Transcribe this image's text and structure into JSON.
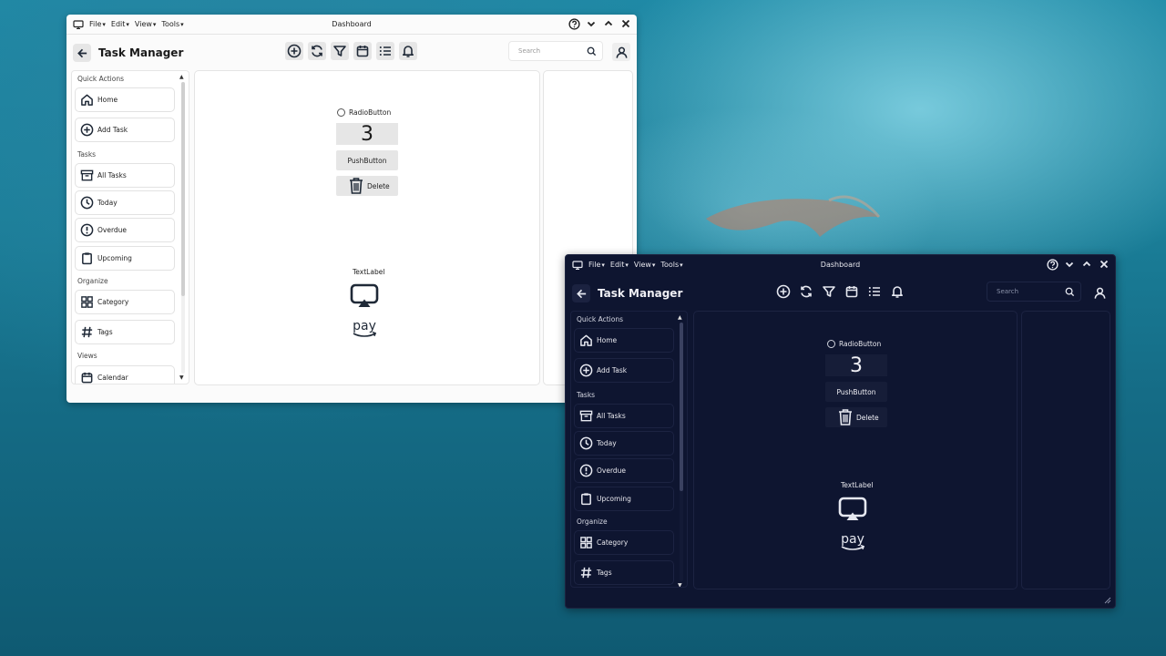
{
  "colors": {
    "light_fg": "#1f2937",
    "dark_fg": "#e6e8f0",
    "dark_bg": "#0e1530"
  },
  "window": {
    "title": "Dashboard",
    "menus": [
      "File",
      "Edit",
      "View",
      "Tools"
    ],
    "controls": [
      "help-icon",
      "chevron-down-icon",
      "chevron-up-icon",
      "close-icon"
    ]
  },
  "header": {
    "page_title": "Task Manager",
    "toolbar_icons": [
      "add-circle-icon",
      "refresh-icon",
      "filter-icon",
      "calendar-icon",
      "list-icon",
      "bell-icon"
    ],
    "search_placeholder": "Search"
  },
  "sidebar": {
    "sections": {
      "quick_actions": "Quick Actions",
      "tasks": "Tasks",
      "organize": "Organize",
      "views": "Views"
    },
    "items": {
      "home": "Home",
      "add_task": "Add Task",
      "all_tasks": "All Tasks",
      "today": "Today",
      "overdue": "Overdue",
      "upcoming": "Upcoming",
      "category": "Category",
      "tags": "Tags",
      "calendar": "Calendar"
    }
  },
  "main": {
    "radio_label": "RadioButton",
    "lcd_value": "3",
    "push_label": "PushButton",
    "delete_label": "Delete",
    "text_label": "TextLabel"
  }
}
